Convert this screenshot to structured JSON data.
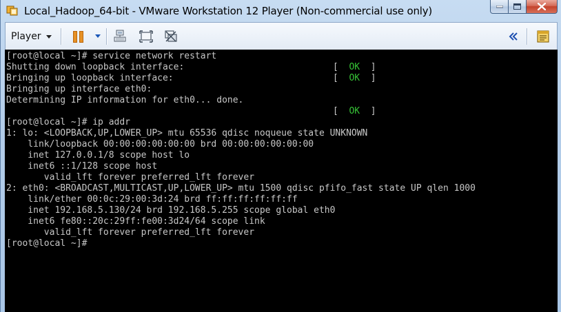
{
  "window": {
    "title": "Local_Hadoop_64-bit - VMware Workstation 12 Player (Non-commercial use only)",
    "buttons": {
      "minimize": "minimize",
      "maximize": "maximize",
      "close": "close"
    }
  },
  "toolbar": {
    "player_label": "Player",
    "buttons": [
      "pause",
      "pause-options",
      "send-ctrl-alt-del",
      "full-screen",
      "unity",
      "collapse-toolbar",
      "removable-devices"
    ]
  },
  "console": {
    "lines": [
      "[root@local ~]# service network restart",
      "Shutting down loopback interface:",
      "Bringing up loopback interface:",
      "Bringing up interface eth0:",
      "Determining IP information for eth0... done.",
      "",
      "[root@local ~]# ip addr",
      "1: lo: <LOOPBACK,UP,LOWER_UP> mtu 65536 qdisc noqueue state UNKNOWN",
      "    link/loopback 00:00:00:00:00:00 brd 00:00:00:00:00:00",
      "    inet 127.0.0.1/8 scope host lo",
      "    inet6 ::1/128 scope host",
      "       valid_lft forever preferred_lft forever",
      "2: eth0: <BROADCAST,MULTICAST,UP,LOWER_UP> mtu 1500 qdisc pfifo_fast state UP qlen 1000",
      "    link/ether 00:0c:29:00:3d:24 brd ff:ff:ff:ff:ff:ff",
      "    inet 192.168.5.130/24 brd 192.168.5.255 scope global eth0",
      "    inet6 fe80::20c:29ff:fe00:3d24/64 scope link",
      "       valid_lft forever preferred_lft forever",
      "[root@local ~]#"
    ],
    "ok_status": {
      "open": "[  ",
      "ok": "OK",
      "close": "  ]"
    }
  },
  "colors": {
    "terminal_bg": "#000000",
    "terminal_fg": "#c7c7c7",
    "ok_green": "#36c436",
    "pause_orange": "#e69126"
  }
}
